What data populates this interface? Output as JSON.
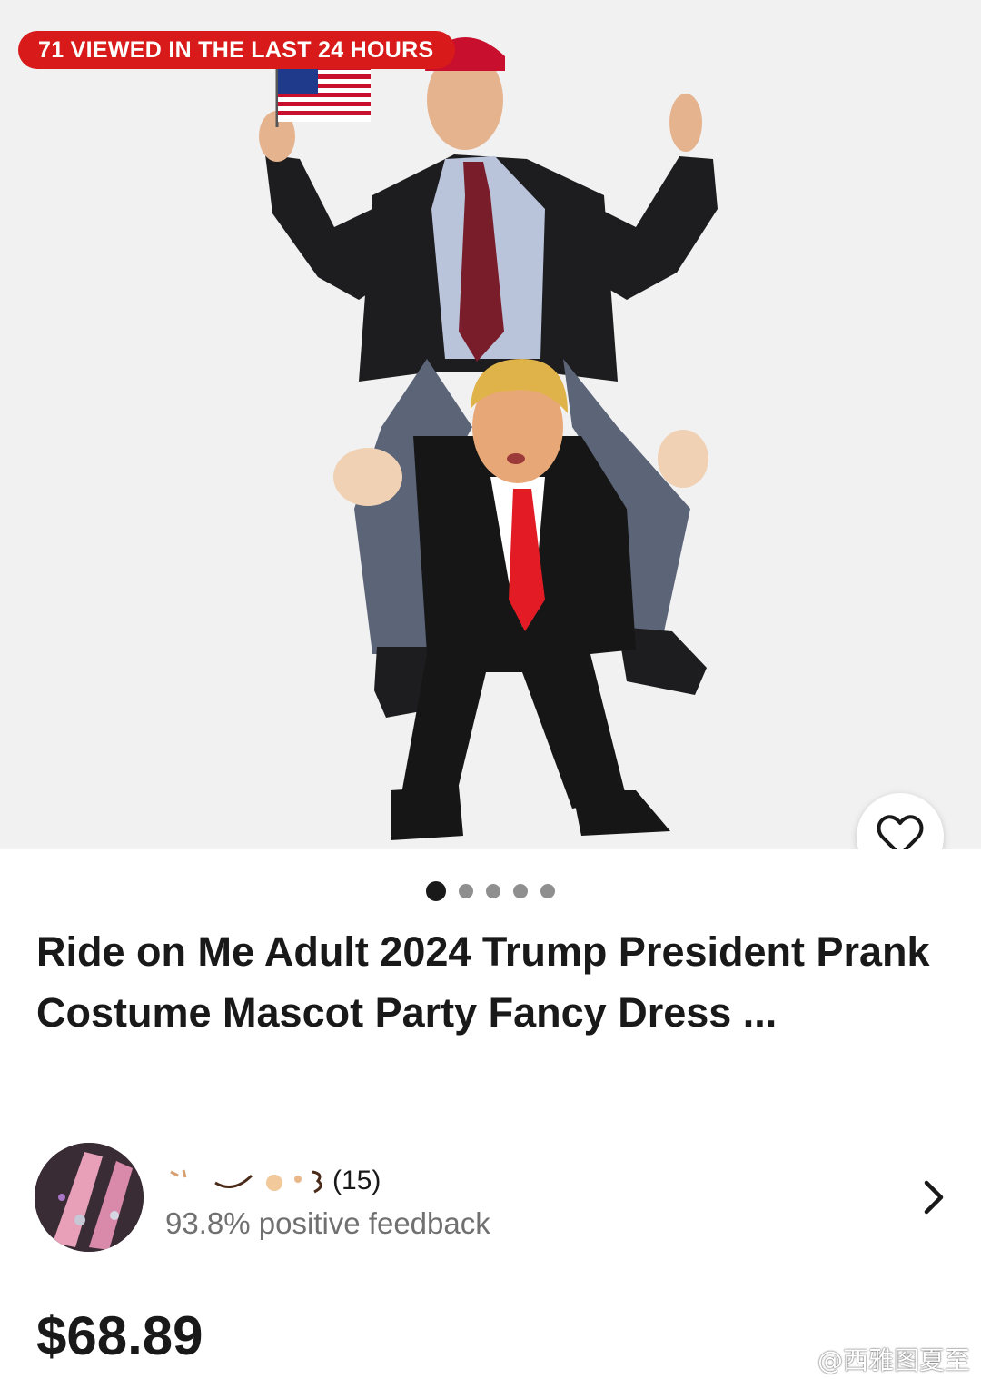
{
  "listing": {
    "views_badge": "71 VIEWED IN THE LAST 24 HOURS",
    "image_pager": {
      "total": 5,
      "active_index": 0
    },
    "title": "Ride on Me Adult 2024 Trump President Prank Costume Mascot Party Fancy Dress ...",
    "price": "$68.89"
  },
  "seller": {
    "feedback_count": "(15)",
    "feedback_percent": "93.8% positive feedback"
  },
  "icons": {
    "favorite": "heart-outline-icon",
    "seller_link": "chevron-right-icon"
  },
  "watermark": {
    "text": "@西雅图夏至"
  },
  "colors": {
    "badge": "#d91a1a",
    "text": "#191919",
    "muted": "#707070"
  }
}
